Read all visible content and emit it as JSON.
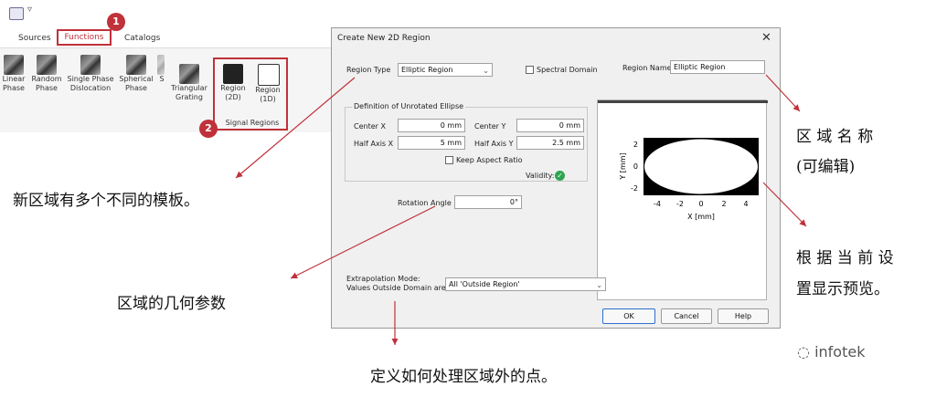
{
  "ribbon": {
    "qa_arrow": "▿",
    "tabs": {
      "sources": "Sources",
      "functions": "Functions",
      "catalogs": "Catalogs"
    },
    "buttons": [
      {
        "label1": "Linear",
        "label2": "Phase"
      },
      {
        "label1": "Random",
        "label2": "Phase"
      },
      {
        "label1": "Single Phase",
        "label2": "Dislocation"
      },
      {
        "label1": "Spherical",
        "label2": "Phase"
      },
      {
        "label1": "S",
        "label2": ""
      }
    ],
    "group2_buttons": [
      {
        "label1": "Triangular",
        "label2": "Grating"
      },
      {
        "label1": "Region",
        "label2": "(2D)"
      },
      {
        "label1": "Region",
        "label2": "(1D)"
      }
    ],
    "group_label": "Signal Regions",
    "badges": [
      "1",
      "2"
    ]
  },
  "dialog": {
    "title": "Create New 2D Region",
    "close": "✕",
    "region_type_label": "Region Type",
    "region_type_value": "Elliptic Region",
    "spectral_domain_label": "Spectral Domain",
    "region_name_label": "Region Name",
    "region_name_value": "Elliptic Region",
    "group_title": "Definition of Unrotated Ellipse",
    "center_x_label": "Center X",
    "center_x_value": "0 mm",
    "center_y_label": "Center Y",
    "center_y_value": "0 mm",
    "half_axis_x_label": "Half Axis X",
    "half_axis_x_value": "5 mm",
    "half_axis_y_label": "Half Axis Y",
    "half_axis_y_value": "2.5 mm",
    "keep_aspect_label": "Keep Aspect Ratio",
    "validity_label": "Validity:",
    "validity_icon": "✓",
    "rotation_label": "Rotation Angle",
    "rotation_value": "0°",
    "extrap_label1": "Extrapolation Mode:",
    "extrap_label2": "Values Outside Domain are",
    "extrap_value": "All 'Outside Region'",
    "ok": "OK",
    "cancel": "Cancel",
    "help": "Help",
    "preview": {
      "ylabel": "Y [mm]",
      "xlabel": "X [mm]",
      "xticks": [
        "-4",
        "-2",
        "0",
        "2",
        "4"
      ],
      "yticks": [
        "2",
        "0",
        "-2"
      ]
    }
  },
  "annotations": {
    "templates": "新区域有多个不同的模板。",
    "geometry": "区域的几何参数",
    "outside": "定义如何处理区域外的点。",
    "name_line1": "区 域 名 称",
    "name_line2": "(可编辑)",
    "preview_line1": "根 据 当 前 设",
    "preview_line2": "置显示预览。"
  },
  "watermark": "infotek",
  "colors": {
    "accent_red": "#c0313a",
    "arrow": "#c0313a"
  }
}
